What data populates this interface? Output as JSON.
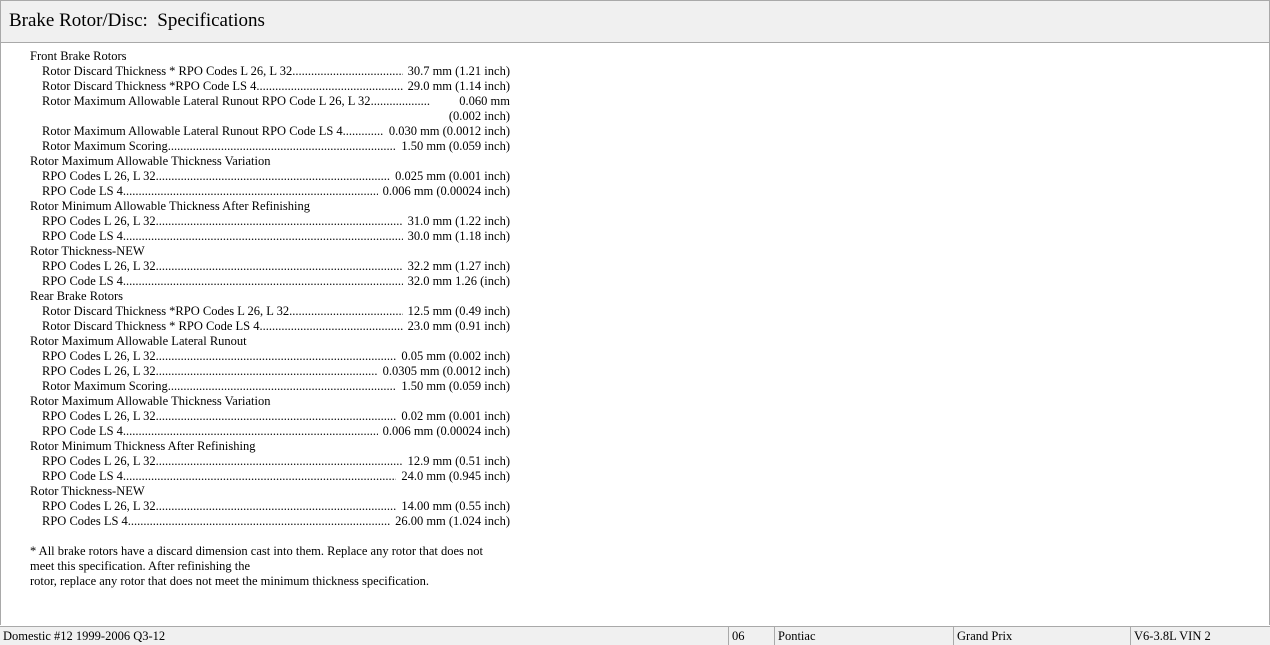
{
  "title": "Brake Rotor/Disc:  Specifications",
  "sections": [
    {
      "header": "Front Brake Rotors",
      "rows": [
        {
          "label": "Rotor Discard Thickness * RPO Codes L 26, L 32",
          "value": "30.7 mm (1.21 inch)"
        },
        {
          "label": "Rotor Discard Thickness *RPO Code LS 4",
          "value": "29.0 mm (1.14 inch)"
        },
        {
          "label": "Rotor Maximum Allowable Lateral Runout RPO Code L 26, L 32",
          "value": "0.060 mm (0.002 inch)",
          "wrap": true
        },
        {
          "label": "Rotor Maximum Allowable Lateral Runout RPO Code LS 4",
          "value": "0.030 mm (0.0012 inch)"
        },
        {
          "label": "Rotor Maximum Scoring",
          "value": "1.50 mm (0.059 inch)"
        }
      ]
    },
    {
      "header": "Rotor Maximum Allowable Thickness Variation",
      "rows": [
        {
          "label": "RPO Codes L 26, L 32",
          "value": "0.025 mm (0.001 inch)"
        },
        {
          "label": "RPO Code LS 4",
          "value": "0.006 mm (0.00024 inch)"
        }
      ]
    },
    {
      "header": "Rotor Minimum Allowable Thickness After Refinishing",
      "rows": [
        {
          "label": "RPO Codes L 26, L 32",
          "value": "31.0 mm (1.22 inch)"
        },
        {
          "label": "RPO Code LS 4",
          "value": "30.0 mm (1.18 inch)"
        }
      ]
    },
    {
      "header": "Rotor Thickness-NEW",
      "rows": [
        {
          "label": "RPO Codes L 26, L 32",
          "value": "32.2 mm (1.27 inch)"
        },
        {
          "label": "RPO Code LS 4",
          "value": "32.0 mm 1.26 (inch)"
        }
      ]
    },
    {
      "header": "Rear Brake Rotors",
      "rows": [
        {
          "label": "Rotor Discard Thickness *RPO Codes L 26, L 32",
          "value": "12.5 mm (0.49 inch)"
        },
        {
          "label": "Rotor Discard Thickness * RPO Code LS 4",
          "value": "23.0 mm (0.91 inch)"
        }
      ]
    },
    {
      "header": "Rotor Maximum Allowable Lateral Runout",
      "rows": [
        {
          "label": "RPO Codes L 26, L 32",
          "value": "0.05 mm (0.002 inch)"
        },
        {
          "label": "RPO Codes L 26, L 32",
          "value": "0.0305 mm (0.0012 inch)"
        },
        {
          "label": "Rotor Maximum Scoring",
          "value": "1.50 mm (0.059 inch)"
        }
      ]
    },
    {
      "header": "Rotor Maximum Allowable Thickness Variation",
      "rows": [
        {
          "label": "RPO Codes L 26, L 32",
          "value": "0.02 mm (0.001 inch)"
        },
        {
          "label": "RPO Code LS 4",
          "value": "0.006 mm (0.00024 inch)"
        }
      ]
    },
    {
      "header": "Rotor Minimum Thickness After Refinishing",
      "rows": [
        {
          "label": "RPO Codes L 26, L 32",
          "value": "12.9 mm (0.51 inch)"
        },
        {
          "label": "RPO Code LS 4",
          "value": "24.0 mm (0.945 inch)"
        }
      ]
    },
    {
      "header": "Rotor Thickness-NEW",
      "rows": [
        {
          "label": "RPO Codes L 26, L 32",
          "value": "14.00 mm (0.55 inch)"
        },
        {
          "label": "RPO Codes LS 4",
          "value": "26.00 mm (1.024 inch)"
        }
      ]
    }
  ],
  "note": {
    "line1": "* All brake rotors have a discard dimension cast into them. Replace any rotor that does not meet this specification. After refinishing the",
    "line2": "rotor, replace any rotor that does not meet the minimum thickness specification."
  },
  "status_bar": {
    "database": "Domestic #12 1999-2006 Q3-12",
    "year": "06",
    "make": "Pontiac",
    "model": "Grand Prix",
    "engine": "V6-3.8L VIN 2"
  },
  "colors": {
    "chrome": "#f0f0f0",
    "border": "#a9a9a9"
  }
}
